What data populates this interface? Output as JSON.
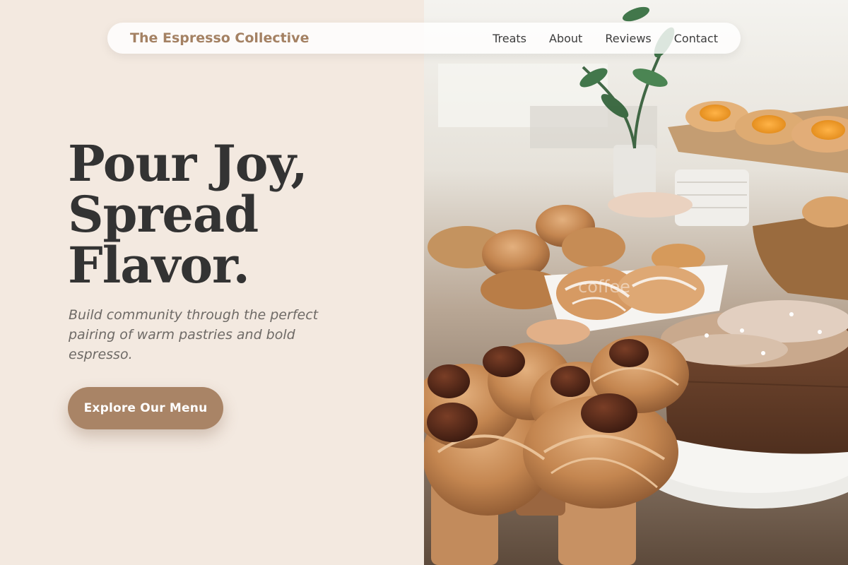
{
  "nav": {
    "brand": "The Espresso Collective",
    "links": [
      "Treats",
      "About",
      "Reviews",
      "Contact"
    ]
  },
  "hero": {
    "headline": [
      "Pour Joy,",
      "Spread",
      "Flavor."
    ],
    "tagline": "Build community through the perfect pairing of warm pastries and bold espresso.",
    "cta_label": "Explore Our Menu"
  },
  "photo": {
    "subject": "pastry-display-photo",
    "watermark": "coffee"
  },
  "colors": {
    "background": "#f3e9e0",
    "accent": "#a98466",
    "brand_text": "#a48163",
    "headline": "#333333",
    "tagline": "#6e6a66"
  }
}
